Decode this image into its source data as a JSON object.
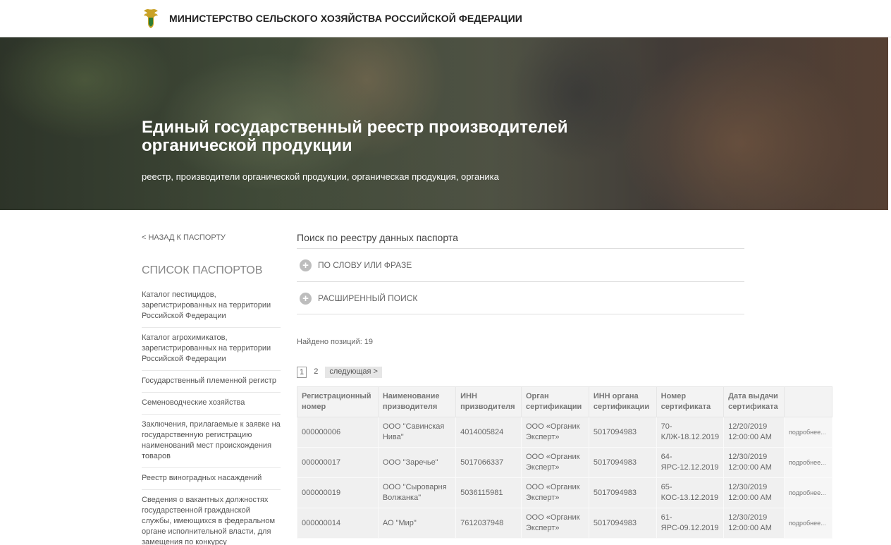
{
  "header": {
    "ministry": "МИНИСТЕРСТВО СЕЛЬСКОГО ХОЗЯЙСТВА РОССИЙСКОЙ ФЕДЕРАЦИИ",
    "emblem_icon": "coat-of-arms-icon"
  },
  "hero": {
    "title": "Единый государственный реестр производителей органической продукции",
    "tags": "реестр, производители органической продукции, органическая продукция, органика"
  },
  "sidebar": {
    "back_link": "< НАЗАД К ПАСПОРТУ",
    "title": "СПИСОК ПАСПОРТОВ",
    "items": [
      {
        "label": "Каталог пестицидов, зарегистрированных на территории Российской Федерации"
      },
      {
        "label": "Каталог агрохимикатов, зарегистрированных на территории Российской Федерации"
      },
      {
        "label": "Государственный племенной регистр"
      },
      {
        "label": "Семеноводческие хозяйства"
      },
      {
        "label": "Заключения, прилагаемые к заявке на государственную регистрацию наименований мест происхождения товаров"
      },
      {
        "label": "Реестр виноградных насаждений"
      },
      {
        "label": "Сведения о вакантных должностях государственной гражданской службы, имеющихся в федеральном органе исполнительной власти, для замещения по конкурсу"
      }
    ]
  },
  "search": {
    "title": "Поиск по реестру данных паспорта",
    "by_phrase": "ПО СЛОВУ ИЛИ ФРАЗЕ",
    "advanced": "РАСШИРЕННЫЙ ПОИСК",
    "expand_icon": "plus-circle-icon"
  },
  "results": {
    "found_label": "Найдено позиций:",
    "found_count": "19"
  },
  "pagination": {
    "pages": [
      "1",
      "2"
    ],
    "current": "1",
    "next": "следующая >"
  },
  "table": {
    "headers": [
      "Регистрационный номер",
      "Наименование призводителя",
      "ИНН призводителя",
      "Орган сертификации",
      "ИНН органа сертификации",
      "Номер сертификата",
      "Дата выдачи сертификата",
      ""
    ],
    "rows": [
      {
        "reg": "000000006",
        "name": "ООО \"Савинская Нива\"",
        "inn": "4014005824",
        "org": "ООО «Органик Эксперт»",
        "org_inn": "5017094983",
        "cert": "70-КЛЖ-18.12.2019",
        "date": "12/20/2019 12:00:00 AM",
        "more": "подробнее..."
      },
      {
        "reg": "000000017",
        "name": "ООО \"Заречье\"",
        "inn": "5017066337",
        "org": "ООО «Органик Эксперт»",
        "org_inn": "5017094983",
        "cert": "64-ЯРС-12.12.2019",
        "date": "12/30/2019 12:00:00 AM",
        "more": "подробнее..."
      },
      {
        "reg": "000000019",
        "name": "ООО \"Сыроварня Волжанка\"",
        "inn": "5036115981",
        "org": "ООО «Органик Эксперт»",
        "org_inn": "5017094983",
        "cert": "65-КОС-13.12.2019",
        "date": "12/30/2019 12:00:00 AM",
        "more": "подробнее..."
      },
      {
        "reg": "000000014",
        "name": "АО \"Мир\"",
        "inn": "7612037948",
        "org": "ООО «Органик Эксперт»",
        "org_inn": "5017094983",
        "cert": "61-ЯРС-09.12.2019",
        "date": "12/30/2019 12:00:00 AM",
        "more": "подробнее..."
      }
    ]
  }
}
